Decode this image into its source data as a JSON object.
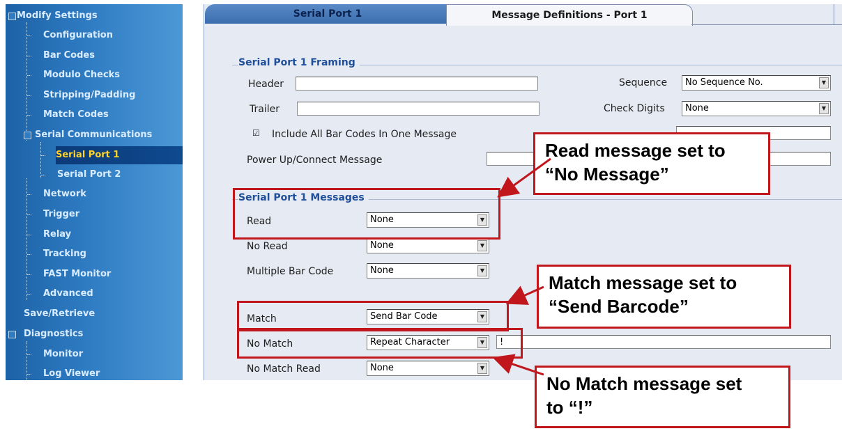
{
  "sidebar": {
    "items": [
      {
        "label": "Modify Settings"
      },
      {
        "label": "Configuration"
      },
      {
        "label": "Bar Codes"
      },
      {
        "label": "Modulo Checks"
      },
      {
        "label": "Stripping/Padding"
      },
      {
        "label": "Match Codes"
      },
      {
        "label": "Serial Communications"
      },
      {
        "label": "Serial Port 1"
      },
      {
        "label": "Serial Port 2"
      },
      {
        "label": "Network"
      },
      {
        "label": "Trigger"
      },
      {
        "label": "Relay"
      },
      {
        "label": "Tracking"
      },
      {
        "label": "FAST Monitor"
      },
      {
        "label": "Advanced"
      },
      {
        "label": "Save/Retrieve"
      },
      {
        "label": "Diagnostics"
      },
      {
        "label": "Monitor"
      },
      {
        "label": "Log Viewer"
      }
    ],
    "active_item": "Serial Port 1"
  },
  "tabs": [
    {
      "label": "Serial Port 1",
      "selected": false
    },
    {
      "label": "Message Definitions - Port 1",
      "selected": true
    }
  ],
  "framing": {
    "title": "Serial Port 1 Framing",
    "header_label": "Header",
    "header_value": "",
    "trailer_label": "Trailer",
    "trailer_value": "",
    "sequence_label": "Sequence",
    "sequence_value": "No Sequence No.",
    "check_digits_label": "Check Digits",
    "check_digits_value": "None",
    "include_all_label": "Include All Bar Codes In One Message",
    "include_all_checked": "☑",
    "power_up_label": "Power Up/Connect Message",
    "power_up_value": ""
  },
  "messages": {
    "title": "Serial Port 1 Messages",
    "read_label": "Read",
    "read_value": "None",
    "no_read_label": "No Read",
    "no_read_value": "None",
    "multiple_label": "Multiple Bar Code",
    "multiple_value": "None",
    "match_label": "Match",
    "match_value": "Send Bar Code",
    "no_match_label": "No Match",
    "no_match_value": "Repeat Character",
    "no_match_char": "!",
    "no_match_read_label": "No Match Read",
    "no_match_read_value": "None"
  },
  "callouts": {
    "read": [
      "Read message set to",
      "“No Message”"
    ],
    "match": [
      "Match message set to",
      "“Send Barcode”"
    ],
    "no_match": [
      "No Match message set",
      "to “!”"
    ]
  },
  "colors": {
    "callout_red": "#c0161c",
    "sidebar_blue": "#2e7bc2",
    "active_text": "#ffd42a"
  }
}
